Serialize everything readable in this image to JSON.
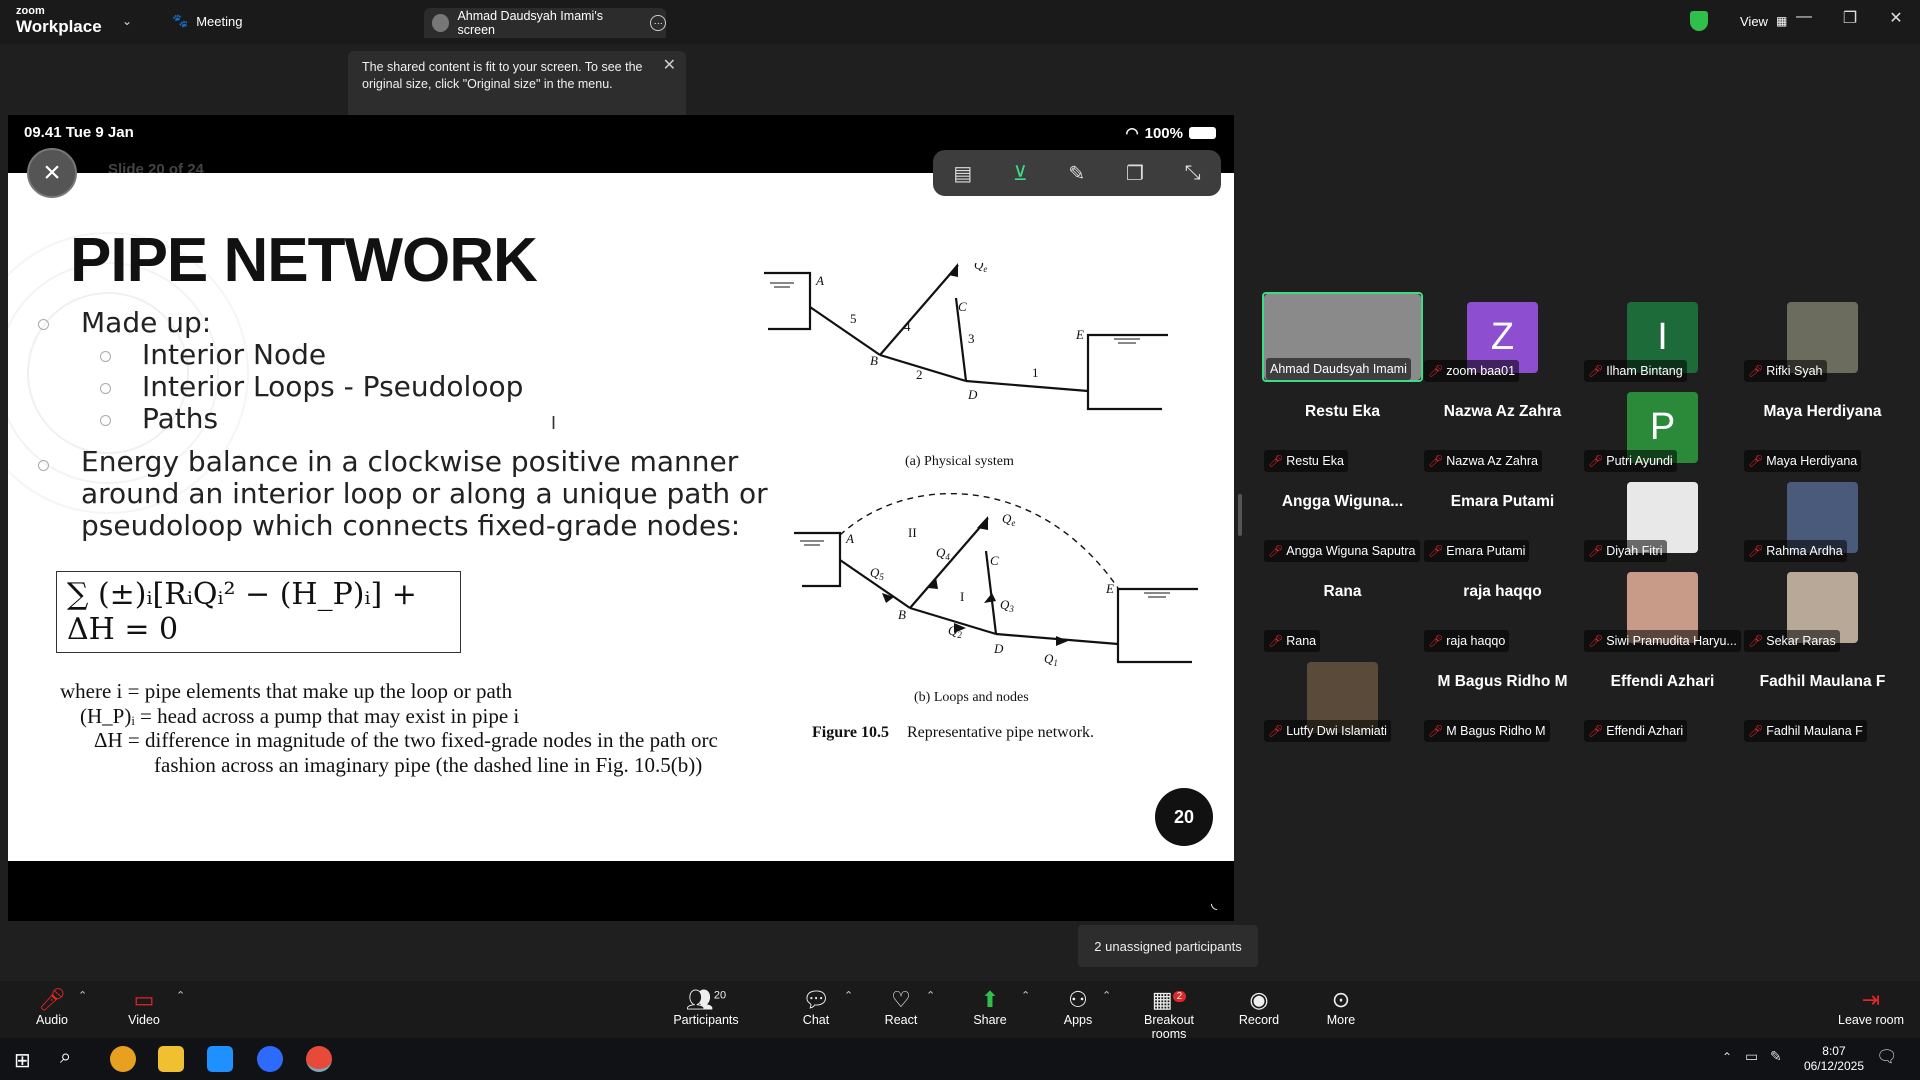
{
  "titlebar": {
    "logo_top": "zoom",
    "logo_bottom": "Workplace",
    "meeting_tab": "Meeting",
    "screen_tab": "Ahmad Daudsyah Imami's screen",
    "view_label": "View"
  },
  "tooltip": {
    "line1": "The shared content is fit to your screen. To see the",
    "line2": "original size, click \"Original size\" in the menu."
  },
  "ipad_status": {
    "time_date": "09.41  Tue 9 Jan",
    "battery": "100%"
  },
  "slide": {
    "faded_header": "Slide 20 of 24",
    "title": "PIPE NETWORK",
    "bullet1": "Made up:",
    "sub1": "Interior Node",
    "sub2": "Interior Loops - Pseudoloop",
    "sub3": "Paths",
    "bullet2_l1": "Energy balance in a clockwise positive manner",
    "bullet2_l2": "around an interior loop or along a unique path or",
    "bullet2_l3": "pseudoloop which connects fixed-grade nodes:",
    "equation": "∑ (±)ᵢ[RᵢQᵢ² − (H_P)ᵢ] + ΔH = 0",
    "where1": "where  i = pipe elements that make up the loop or path",
    "where2": "(H_P)ᵢ = head across a pump that may exist in pipe i",
    "where3": "ΔH = difference in magnitude of the two fixed-grade nodes in the path orc",
    "where4": "fashion across an imaginary pipe (the dashed line in Fig. 10.5(b))",
    "fig_a_caption": "(a) Physical system",
    "fig_b_caption": "(b) Loops and nodes",
    "figure_caption_num": "Figure 10.5",
    "figure_caption_text": "Representative pipe network.",
    "page_number": "20"
  },
  "unassigned": "2 unassigned participants",
  "participants": [
    {
      "label": "Ahmad Daudsyah Imami",
      "name_display": "",
      "type": "photo",
      "color": "#8a8a8a"
    },
    {
      "label": "zoom baa01",
      "name_display": "",
      "type": "initial",
      "initial": "Z",
      "color": "#8e4ed0"
    },
    {
      "label": "Ilham Bintang",
      "name_display": "",
      "type": "initial",
      "initial": "I",
      "color": "#1e6b3a"
    },
    {
      "label": "Rifki Syah",
      "name_display": "",
      "type": "photo",
      "color": "#6b6b5e"
    },
    {
      "label": "Restu Eka",
      "name_display": "Restu Eka",
      "type": "name"
    },
    {
      "label": "Nazwa Az Zahra",
      "name_display": "Nazwa Az Zahra",
      "type": "name"
    },
    {
      "label": "Putri Ayundi",
      "name_display": "",
      "type": "initial",
      "initial": "P",
      "color": "#2a8a3a"
    },
    {
      "label": "Maya Herdiyana",
      "name_display": "Maya Herdiyana",
      "type": "name"
    },
    {
      "label": "Angga Wiguna Saputra",
      "name_display": "Angga  Wiguna...",
      "type": "name"
    },
    {
      "label": "Emara Putami",
      "name_display": "Emara Putami",
      "type": "name"
    },
    {
      "label": "Diyah Fitri",
      "name_display": "",
      "type": "photo",
      "color": "#e8e8e8"
    },
    {
      "label": "Rahma Ardha",
      "name_display": "",
      "type": "photo",
      "color": "#4a5a7a"
    },
    {
      "label": "Rana",
      "name_display": "Rana",
      "type": "name"
    },
    {
      "label": "raja haqqo",
      "name_display": "raja haqqo",
      "type": "name"
    },
    {
      "label": "Siwi Pramudita Haryu...",
      "name_display": "",
      "type": "photo",
      "color": "#c89a88"
    },
    {
      "label": "Sekar Raras",
      "name_display": "",
      "type": "photo",
      "color": "#b8a898"
    },
    {
      "label": "Lutfy Dwi Islamiati",
      "name_display": "",
      "type": "photo",
      "color": "#5a4a3a"
    },
    {
      "label": "M Bagus Ridho M",
      "name_display": "M Bagus Ridho M",
      "type": "name"
    },
    {
      "label": "Effendi Azhari",
      "name_display": "Effendi Azhari",
      "type": "name"
    },
    {
      "label": "Fadhil Maulana F",
      "name_display": "Fadhil Maulana F",
      "type": "name"
    }
  ],
  "toolbar": {
    "audio": "Audio",
    "video": "Video",
    "participants": "Participants",
    "participants_count": "20",
    "chat": "Chat",
    "react": "React",
    "share": "Share",
    "apps": "Apps",
    "breakout": "Breakout rooms",
    "breakout_badge": "2",
    "record": "Record",
    "more": "More",
    "leave": "Leave room"
  },
  "taskbar": {
    "time": "8:07",
    "date": "06/12/2025"
  },
  "colors": {
    "accent_green": "#2fbf4a",
    "muted_red": "#e02828",
    "active_speaker": "#3ddc84"
  }
}
